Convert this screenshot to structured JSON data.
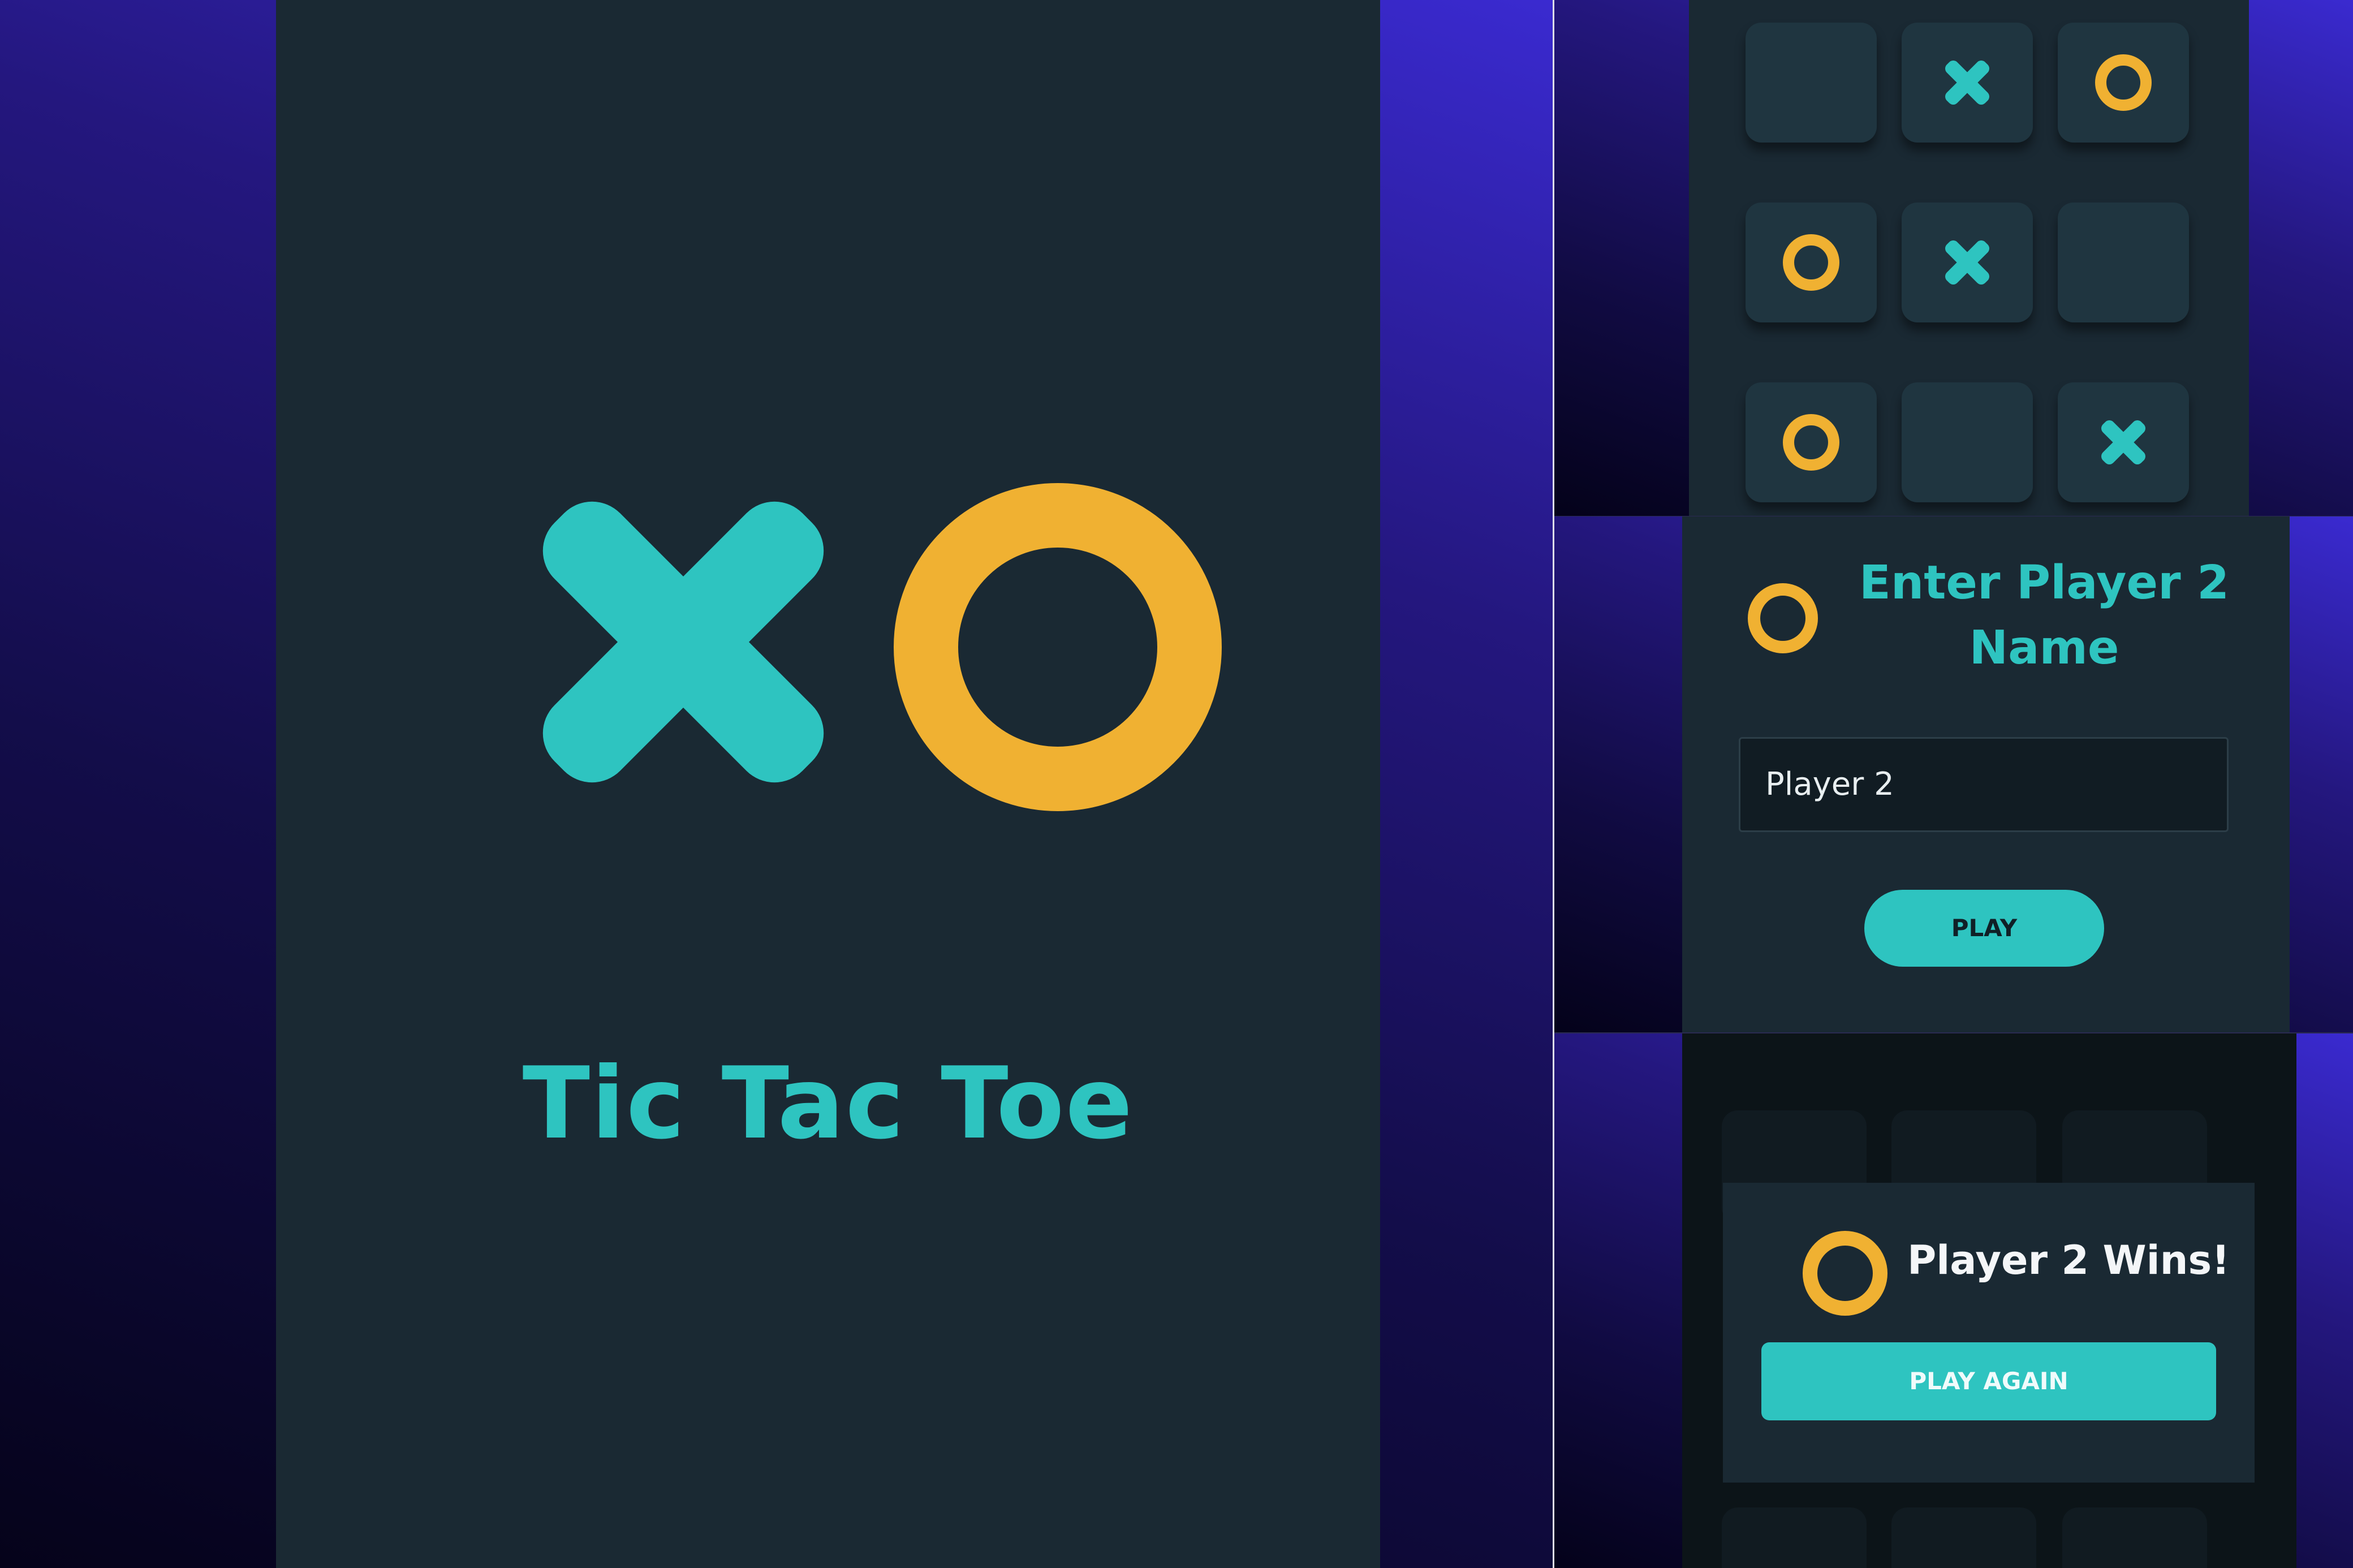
{
  "colors": {
    "screen_bg": "#1a2933",
    "x_mark": "#2ec4c0",
    "o_mark": "#f0b132",
    "tile_bg": "#1f3540",
    "accent": "#2ec4c0"
  },
  "splash": {
    "logo_icons": [
      "x-icon",
      "o-icon"
    ],
    "title": "Tic Tac Toe"
  },
  "board": {
    "cells": [
      [
        "",
        "X",
        "O"
      ],
      [
        "O",
        "X",
        ""
      ],
      [
        "O",
        "",
        "X"
      ]
    ]
  },
  "name_entry": {
    "player_icon": "o-icon",
    "heading_line1": "Enter Player 2",
    "heading_line2": "Name",
    "input_value": "Player 2",
    "play_label": "PLAY"
  },
  "result": {
    "winner_icon": "o-icon",
    "message": "Player 2 Wins!",
    "play_again_label": "PLAY AGAIN"
  }
}
